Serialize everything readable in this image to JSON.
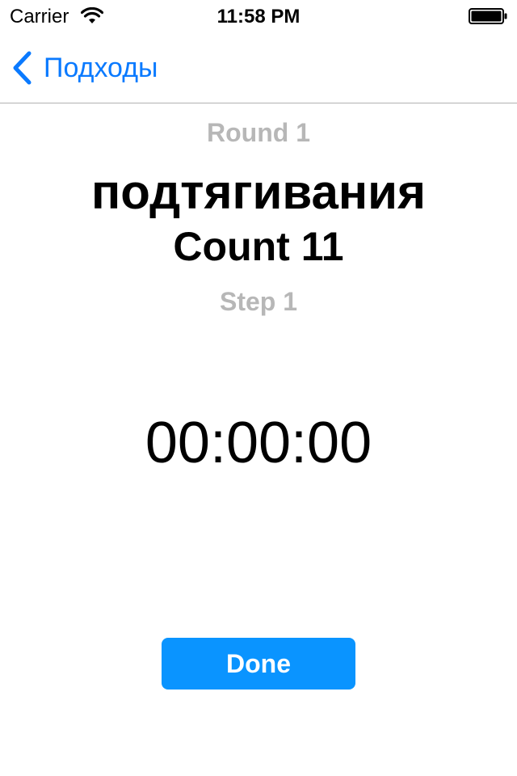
{
  "status_bar": {
    "carrier": "Carrier",
    "time": "11:58 PM",
    "wifi_icon": "wifi-icon",
    "battery_icon": "battery-full-icon"
  },
  "nav_bar": {
    "back_label": "Подходы",
    "back_icon": "chevron-left-icon",
    "accent_color": "#0a7aff"
  },
  "workout": {
    "round": "Round 1",
    "exercise": "подтягивания",
    "count": "Count 11",
    "step": "Step 1",
    "timer": "00:00:00"
  },
  "actions": {
    "done_label": "Done",
    "done_color": "#0a94ff"
  }
}
